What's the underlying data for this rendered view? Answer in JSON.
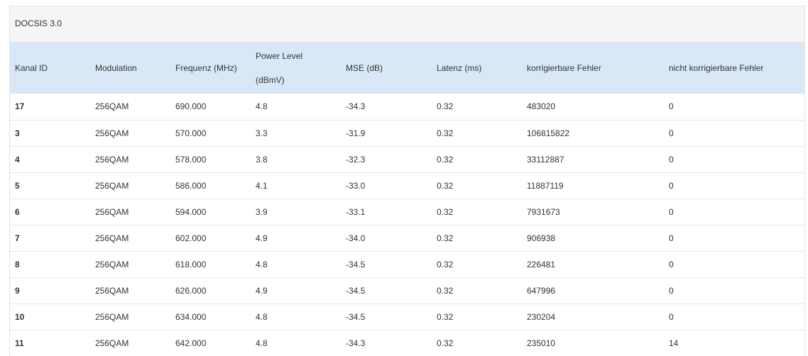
{
  "panel": {
    "title": "DOCSIS 3.0"
  },
  "table": {
    "headers": {
      "kanal_id": "Kanal ID",
      "modulation": "Modulation",
      "frequenz": "Frequenz (MHz)",
      "power_level_1": "Power Level",
      "power_level_2": "(dBmV)",
      "mse": "MSE (dB)",
      "latenz": "Latenz (ms)",
      "korr": "korrigierbare Fehler",
      "nicht_korr": "nicht korrigierbare Fehler"
    },
    "rows": [
      [
        "17",
        "256QAM",
        "690.000",
        "4.8",
        "-34.3",
        "0.32",
        "483020",
        "0"
      ],
      [
        "3",
        "256QAM",
        "570.000",
        "3.3",
        "-31.9",
        "0.32",
        "106815822",
        "0"
      ],
      [
        "4",
        "256QAM",
        "578.000",
        "3.8",
        "-32.3",
        "0.32",
        "33112887",
        "0"
      ],
      [
        "5",
        "256QAM",
        "586.000",
        "4.1",
        "-33.0",
        "0.32",
        "11887119",
        "0"
      ],
      [
        "6",
        "256QAM",
        "594.000",
        "3.9",
        "-33.1",
        "0.32",
        "7931673",
        "0"
      ],
      [
        "7",
        "256QAM",
        "602.000",
        "4.9",
        "-34.0",
        "0.32",
        "906938",
        "0"
      ],
      [
        "8",
        "256QAM",
        "618.000",
        "4.8",
        "-34.5",
        "0.32",
        "226481",
        "0"
      ],
      [
        "9",
        "256QAM",
        "626.000",
        "4.9",
        "-34.5",
        "0.32",
        "647996",
        "0"
      ],
      [
        "10",
        "256QAM",
        "634.000",
        "4.8",
        "-34.5",
        "0.32",
        "230204",
        "0"
      ],
      [
        "11",
        "256QAM",
        "642.000",
        "4.8",
        "-34.3",
        "0.32",
        "235010",
        "14"
      ]
    ]
  }
}
